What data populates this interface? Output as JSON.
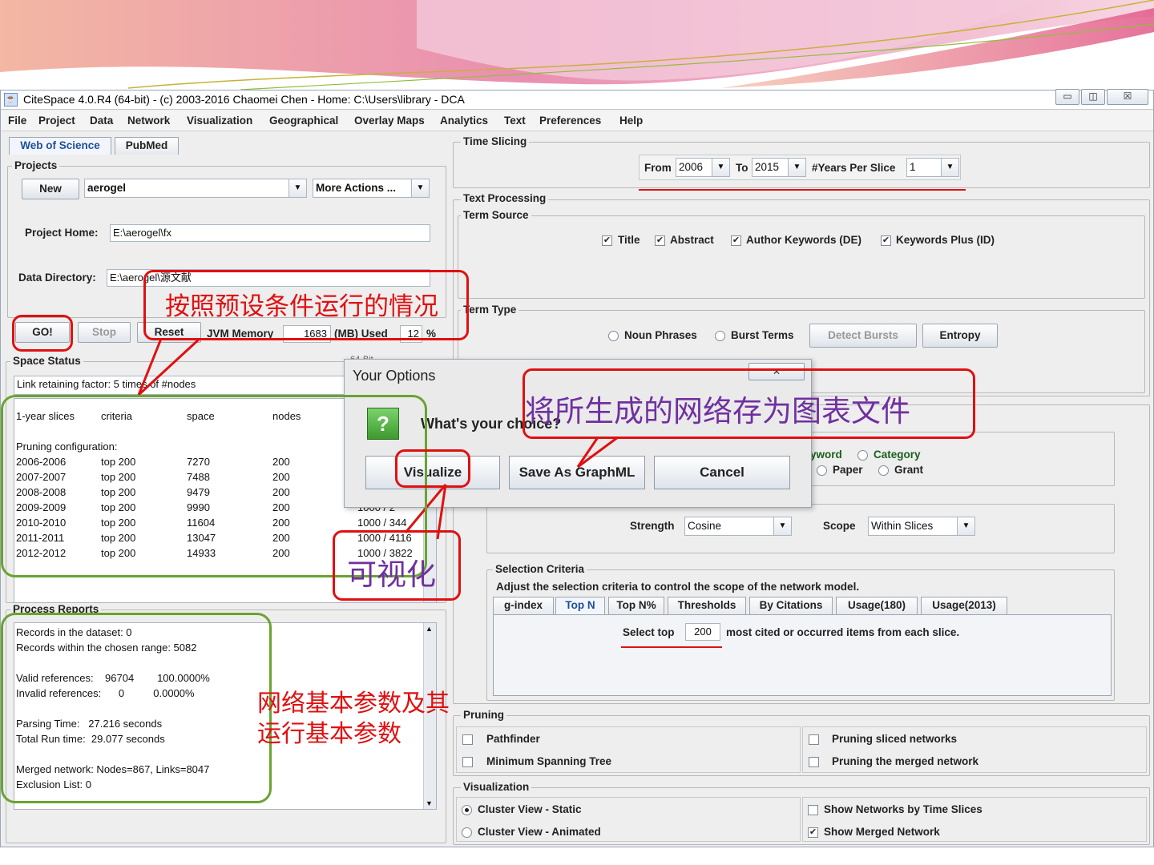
{
  "window": {
    "title": "CiteSpace 4.0.R4 (64-bit) - (c) 2003-2016 Chaomei Chen - Home: C:\\Users\\library - DCA",
    "min": "▭",
    "max": "◫",
    "close": "☒"
  },
  "menu": [
    "File",
    "Project",
    "Data",
    "Network",
    "Visualization",
    "Geographical",
    "Overlay Maps",
    "Analytics",
    "Text",
    "Preferences",
    "Help"
  ],
  "left": {
    "tabs": [
      "Web of Science",
      "PubMed"
    ],
    "projects": {
      "legend": "Projects",
      "new_label": "New",
      "project_value": "aerogel",
      "more_actions": "More Actions ...",
      "home_label": "Project Home:",
      "home_value": "E:\\aerogel\\fx",
      "data_label": "Data Directory:",
      "data_value": "E:\\aerogel\\源文献"
    },
    "controls": {
      "go": "GO!",
      "stop": "Stop",
      "reset": "Reset",
      "jvm_label": "JVM Memory",
      "jvm_value": "1683",
      "used_label": "(MB) Used",
      "used_value": "12",
      "pct": "%"
    },
    "space": {
      "legend": "Space Status",
      "partial": "64-Bit ...",
      "link_factor": "Link retaining factor: 5 times of #nodes",
      "headers": [
        "1-year slices",
        "criteria",
        "space",
        "nodes"
      ],
      "pruning": "Pruning configuration:",
      "rows": [
        {
          "slice": "2006-2006",
          "criteria": "top 200",
          "space": "7270",
          "nodes": "200",
          "extra": ""
        },
        {
          "slice": "2007-2007",
          "criteria": "top 200",
          "space": "7488",
          "nodes": "200",
          "extra": ""
        },
        {
          "slice": "2008-2008",
          "criteria": "top 200",
          "space": "9479",
          "nodes": "200",
          "extra": ""
        },
        {
          "slice": "2009-2009",
          "criteria": "top 200",
          "space": "9990",
          "nodes": "200",
          "extra": "1000 / 2"
        },
        {
          "slice": "2010-2010",
          "criteria": "top 200",
          "space": "11604",
          "nodes": "200",
          "extra": "1000 / 344"
        },
        {
          "slice": "2011-2011",
          "criteria": "top 200",
          "space": "13047",
          "nodes": "200",
          "extra": "1000 / 4116"
        },
        {
          "slice": "2012-2012",
          "criteria": "top 200",
          "space": "14933",
          "nodes": "200",
          "extra": "1000 / 3822"
        }
      ]
    },
    "process": {
      "legend": "Process Reports",
      "lines": [
        "Records in the dataset: 0",
        "Records within the chosen range: 5082",
        "",
        "Valid references:    96704        100.0000%",
        "Invalid references:      0          0.0000%",
        "",
        "Parsing Time:   27.216 seconds",
        "Total Run time:  29.077 seconds",
        "",
        "Merged network: Nodes=867, Links=8047",
        "Exclusion List: 0"
      ]
    }
  },
  "right": {
    "time_slicing": {
      "legend": "Time Slicing",
      "from_label": "From",
      "from_value": "2006",
      "to_label": "To",
      "to_value": "2015",
      "years_label": "#Years Per Slice",
      "years_value": "1"
    },
    "text_processing": {
      "legend": "Text Processing",
      "term_source": "Term Source",
      "sources": [
        {
          "label": "Title",
          "checked": true
        },
        {
          "label": "Abstract",
          "checked": true
        },
        {
          "label": "Author Keywords (DE)",
          "checked": true
        },
        {
          "label": "Keywords Plus (ID)",
          "checked": true
        }
      ],
      "term_type": "Term Type",
      "noun_phrases": "Noun Phrases",
      "burst_terms": "Burst Terms",
      "detect_bursts": "Detect Bursts",
      "entropy": "Entropy"
    },
    "node_types": {
      "keyword_partial": "yword",
      "category": "Category",
      "paper": "Paper",
      "grant": "Grant"
    },
    "links": {
      "strength_label": "Strength",
      "strength_value": "Cosine",
      "scope_label": "Scope",
      "scope_value": "Within Slices"
    },
    "selection": {
      "legend": "Selection Criteria",
      "description": "Adjust the selection criteria to control the scope of the network model.",
      "tabs": [
        "g-index",
        "Top N",
        "Top N%",
        "Thresholds",
        "By Citations",
        "Usage(180)",
        "Usage(2013)"
      ],
      "select_top_label": "Select top",
      "select_top_value": "200",
      "select_top_suffix": "most cited or occurred items from each slice."
    },
    "pruning": {
      "legend": "Pruning",
      "items": [
        "Pathfinder",
        "Pruning sliced networks",
        "Minimum Spanning Tree",
        "Pruning the merged network"
      ]
    },
    "visualization": {
      "legend": "Visualization",
      "static": "Cluster View - Static",
      "animated": "Cluster View - Animated",
      "by_slices": "Show Networks by Time Slices",
      "merged": "Show Merged Network"
    }
  },
  "dialog": {
    "title": "Your Options",
    "question": "What's your choice?",
    "visualize": "Visualize",
    "save": "Save As GraphML",
    "cancel": "Cancel",
    "icon": "?"
  },
  "annotations": {
    "preset": "按照预设条件运行的情况",
    "graphml": "将所生成的网络存为图表文件",
    "visualize": "可视化",
    "params_1": "网络基本参数及其",
    "params_2": "运行基本参数"
  },
  "colors": {
    "annotation_red": "#e01010",
    "annotation_green": "#6aa332",
    "annotation_text_red": "#e01010",
    "annotation_text_purple": "#7030a0",
    "banner_pink": "#e879a8"
  }
}
